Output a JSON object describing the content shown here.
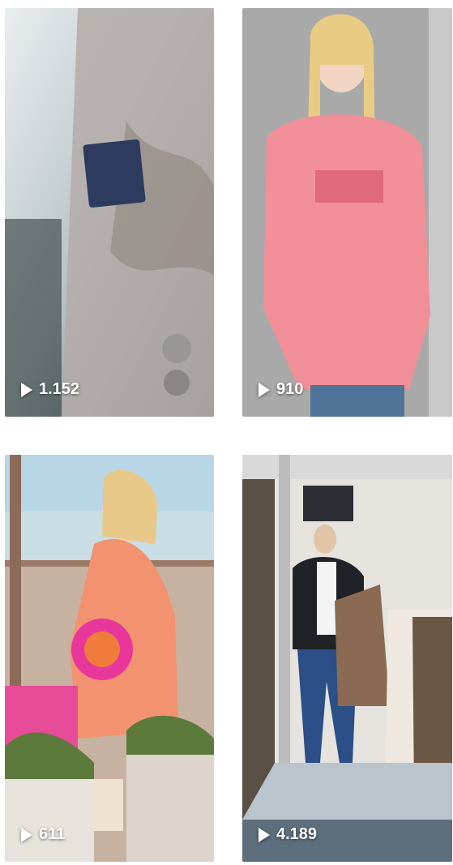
{
  "videos": [
    {
      "views": "1.152",
      "icon": "play-icon"
    },
    {
      "views": "910",
      "icon": "play-icon"
    },
    {
      "views": "611",
      "icon": "play-icon"
    },
    {
      "views": "4.189",
      "icon": "play-icon"
    }
  ],
  "colors": {
    "background": "#ffffff",
    "overlay_text": "#ffffff"
  }
}
